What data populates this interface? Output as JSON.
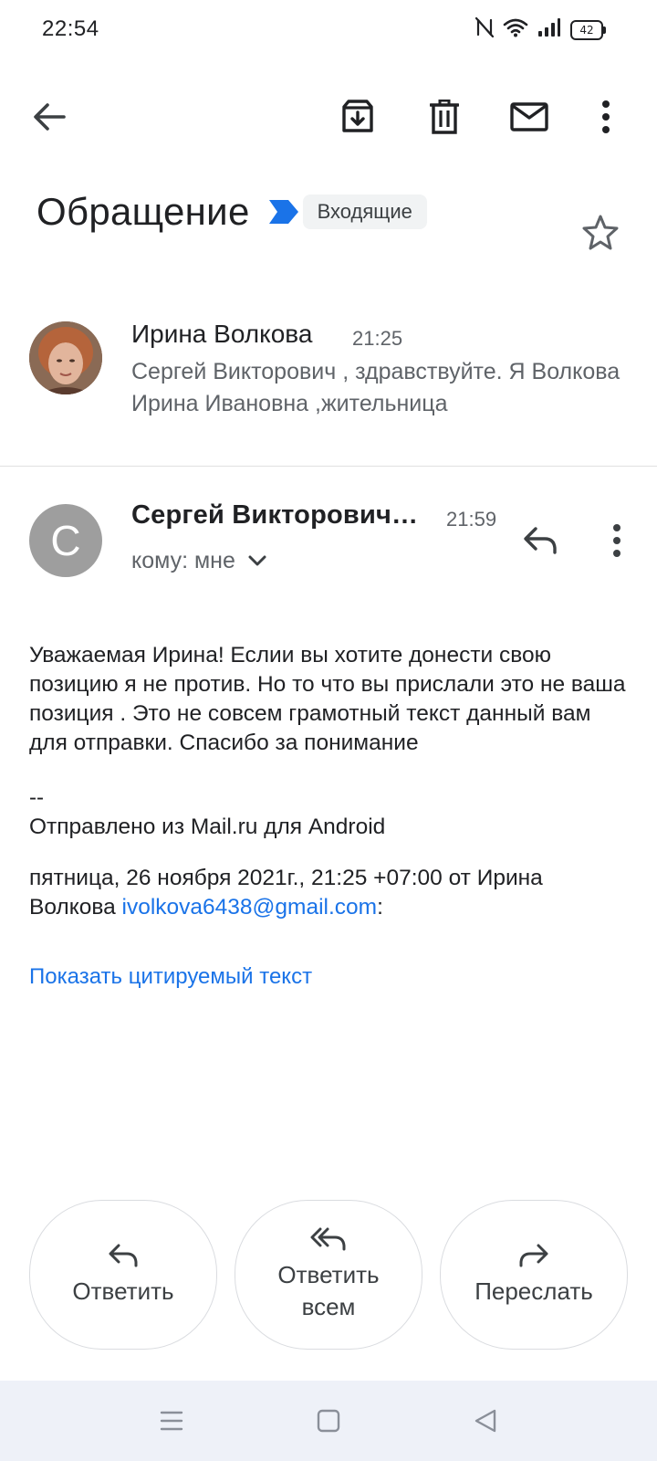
{
  "status_bar": {
    "time": "22:54",
    "battery": "42",
    "icons": [
      "nfc-icon",
      "wifi-icon",
      "signal-icon",
      "battery-icon"
    ]
  },
  "toolbar": {
    "back": "back-arrow-icon",
    "archive": "archive-icon",
    "delete": "trash-icon",
    "mark_unread": "mail-icon",
    "more": "more-vert-icon"
  },
  "subject": {
    "title": "Обращение",
    "label": "Входящие",
    "star": "star-outline-icon",
    "important_color": "#1a73e8"
  },
  "message1": {
    "sender": "Ирина Волкова",
    "time": "21:25",
    "snippet": "Сергей Викторович , здравствуйте. Я Волкова Ирина Ивановна ,жительница"
  },
  "message2": {
    "avatar_letter": "С",
    "avatar_color": "#9e9e9e",
    "sender": "Сергей Викторович…",
    "time": "21:59",
    "to": "кому: мне",
    "body": "Уважаемая Ирина! Еслии вы хотите донести свою позицию  я не против.  Но  то что вы прислали это не ваша позиция . Это не совсем грамотный текст данный вам для отправки. Спасибо за понимание",
    "signature_dash": "--",
    "signature": "Отправлено из Mail.ru для Android",
    "quote_header_prefix": "пятница, 26 ноября 2021г., 21:25 +07:00 от Ирина Волкова ",
    "quote_email": "ivolkova6438@gmail.com",
    "quote_header_suffix": ":",
    "show_quoted": "Показать цитируемый текст",
    "link_color": "#1a73e8"
  },
  "actions": {
    "reply": "Ответить",
    "reply_all": "Ответить всем",
    "forward": "Переслать"
  },
  "navbar": {
    "menu": "menu-icon",
    "home": "home-square-icon",
    "back": "back-triangle-icon"
  }
}
